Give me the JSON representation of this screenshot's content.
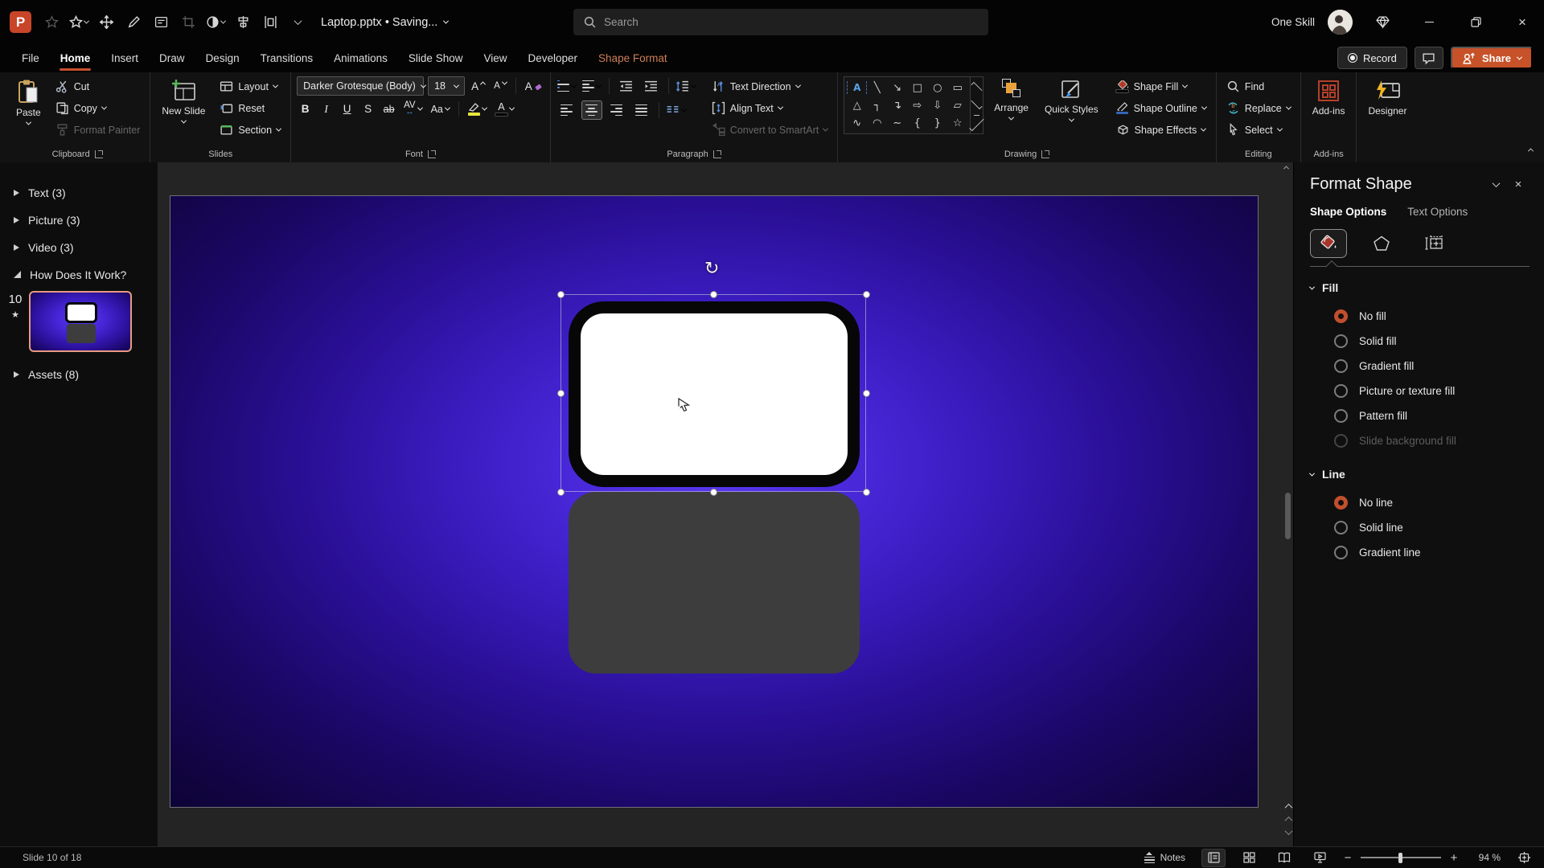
{
  "titlebar": {
    "app_initial": "P",
    "doc_title": "Laptop.pptx • Saving...",
    "search_placeholder": "Search",
    "user_name": "One Skill"
  },
  "ribbon": {
    "tabs": [
      {
        "label": "File"
      },
      {
        "label": "Home",
        "active": true
      },
      {
        "label": "Insert"
      },
      {
        "label": "Draw"
      },
      {
        "label": "Design"
      },
      {
        "label": "Transitions"
      },
      {
        "label": "Animations"
      },
      {
        "label": "Slide Show"
      },
      {
        "label": "View"
      },
      {
        "label": "Developer"
      },
      {
        "label": "Shape Format",
        "contextual": true
      }
    ],
    "record_label": "Record",
    "share_label": "Share",
    "groups": {
      "clipboard": {
        "label": "Clipboard",
        "paste": "Paste",
        "cut": "Cut",
        "copy": "Copy",
        "format_painter": "Format Painter"
      },
      "slides": {
        "label": "Slides",
        "new_slide": "New Slide",
        "layout": "Layout",
        "reset": "Reset",
        "section": "Section"
      },
      "font": {
        "label": "Font",
        "font_name": "Darker Grotesque (Body)",
        "font_size": "18",
        "bold": "B",
        "italic": "I",
        "underline": "U",
        "shadow": "S",
        "strikethrough": "ab",
        "char_spacing": "AV",
        "change_case": "Aa",
        "font_color": "A"
      },
      "paragraph": {
        "label": "Paragraph",
        "text_direction": "Text Direction",
        "align_text": "Align Text",
        "convert_smartart": "Convert to SmartArt"
      },
      "drawing": {
        "label": "Drawing",
        "arrange": "Arrange",
        "quick_styles": "Quick Styles",
        "shape_fill": "Shape Fill",
        "shape_outline": "Shape Outline",
        "shape_effects": "Shape Effects",
        "shapes": [
          {
            "name": "text-box",
            "glyph": "A"
          },
          {
            "name": "line",
            "glyph": "╲"
          },
          {
            "name": "line-arrow",
            "glyph": "↘"
          },
          {
            "name": "rectangle",
            "glyph": "□"
          },
          {
            "name": "oval",
            "glyph": "○"
          },
          {
            "name": "rounded-rectangle",
            "glyph": "▭"
          },
          {
            "name": "triangle",
            "glyph": "△"
          },
          {
            "name": "elbow-connector",
            "glyph": "┐"
          },
          {
            "name": "elbow-arrow-connector",
            "glyph": "↴"
          },
          {
            "name": "arrow-right",
            "glyph": "⇨"
          },
          {
            "name": "arrow-down",
            "glyph": "⇩"
          },
          {
            "name": "freeform",
            "glyph": "▱"
          },
          {
            "name": "scribble",
            "glyph": "∿"
          },
          {
            "name": "arc",
            "glyph": "◠"
          },
          {
            "name": "curve",
            "glyph": "∼"
          },
          {
            "name": "brace-left",
            "glyph": "{"
          },
          {
            "name": "brace-right",
            "glyph": "}"
          },
          {
            "name": "star",
            "glyph": "☆"
          }
        ]
      },
      "editing": {
        "label": "Editing",
        "find": "Find",
        "replace": "Replace",
        "select": "Select"
      },
      "addins": {
        "label": "Add-ins",
        "button": "Add-ins"
      },
      "designer": {
        "label": "Designer"
      }
    }
  },
  "sidebar": {
    "sections": [
      {
        "label": "Text (3)",
        "expanded": false
      },
      {
        "label": "Picture (3)",
        "expanded": false
      },
      {
        "label": "Video (3)",
        "expanded": false
      },
      {
        "label": "How Does It Work?",
        "expanded": true,
        "slides": [
          {
            "number": "10",
            "selected": true,
            "animated": true
          }
        ]
      },
      {
        "label": "Assets (8)",
        "expanded": false
      }
    ]
  },
  "format_shape": {
    "title": "Format Shape",
    "tabs": [
      {
        "label": "Shape Options",
        "active": true
      },
      {
        "label": "Text Options",
        "active": false
      }
    ],
    "fill": {
      "title": "Fill",
      "options": [
        {
          "label": "No fill",
          "selected": true
        },
        {
          "label": "Solid fill"
        },
        {
          "label": "Gradient fill"
        },
        {
          "label": "Picture or texture fill"
        },
        {
          "label": "Pattern fill"
        },
        {
          "label": "Slide background fill",
          "disabled": true
        }
      ]
    },
    "line": {
      "title": "Line",
      "options": [
        {
          "label": "No line",
          "selected": true
        },
        {
          "label": "Solid line"
        },
        {
          "label": "Gradient line"
        }
      ]
    }
  },
  "statusbar": {
    "slide_counter": "Slide 10 of 18",
    "notes_label": "Notes",
    "zoom_level": "94 %"
  },
  "colors": {
    "accent": "#C7512E",
    "contextual_tab": "#CE7E58",
    "selected_radio": "#C14F2D",
    "thumbnail_selection": "#E89A80",
    "slide_center": "#5B3AF0",
    "slide_edge": "#0D0335",
    "arrange_orange": "#E9A23B"
  }
}
